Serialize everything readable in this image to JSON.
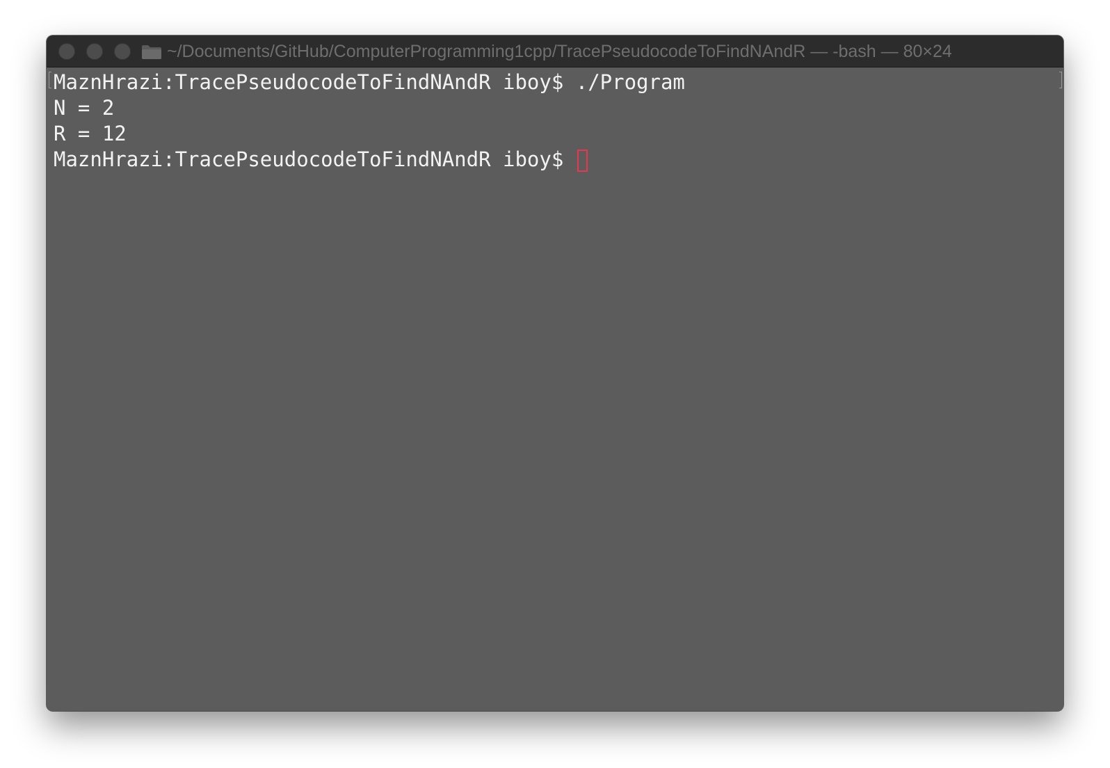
{
  "window": {
    "title": "~/Documents/GitHub/ComputerProgramming1cpp/TracePseudocodeToFindNAndR — -bash — 80×24",
    "title_icon": "folder-icon",
    "traffic_lights": [
      "close-button",
      "minimize-button",
      "zoom-button"
    ]
  },
  "terminal": {
    "lines": [
      "MaznHrazi:TracePseudocodeToFindNAndR iboy$ ./Program",
      "N = 2",
      "R = 12",
      "MaznHrazi:TracePseudocodeToFindNAndR iboy$ "
    ],
    "cursor_color": "#e8384f",
    "background_color": "#5c5c5c",
    "text_color": "#f2f2f2"
  }
}
